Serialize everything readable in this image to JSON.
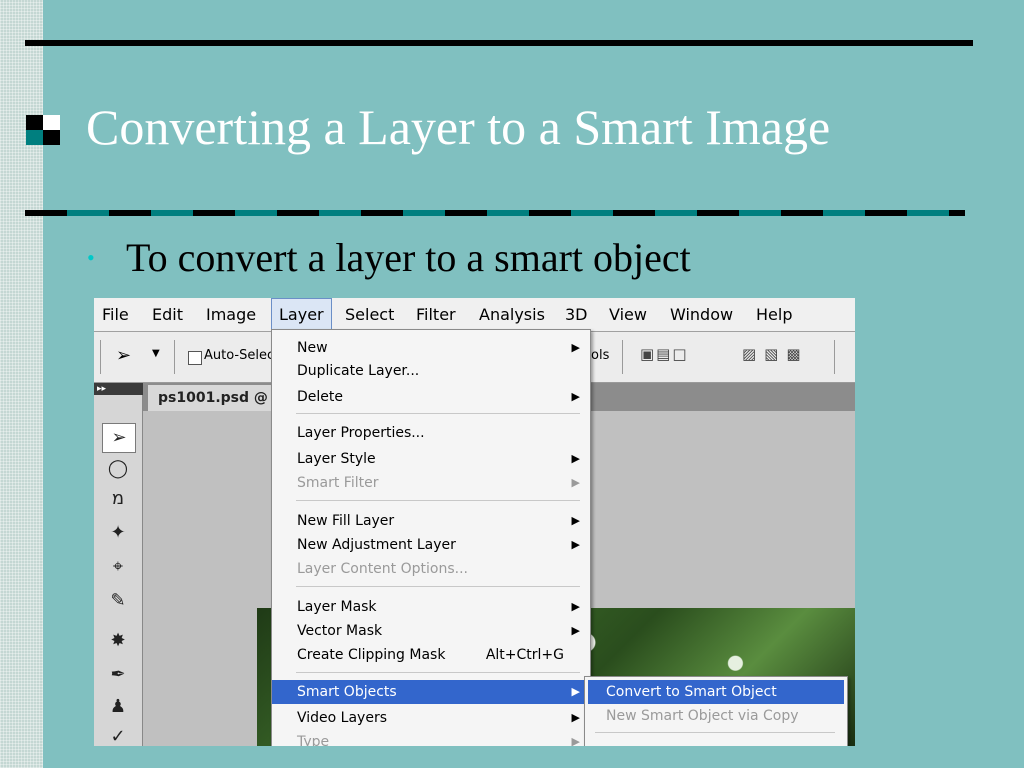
{
  "slide": {
    "title": "Converting a Layer to a Smart Image",
    "bullet": "To convert a layer to a smart object"
  },
  "colors": {
    "background": "#80c0c0",
    "title_text": "#ffffff",
    "menu_highlight": "#3366cc",
    "bullet": "#00c8c8"
  },
  "app": {
    "menubar": [
      "File",
      "Edit",
      "Image",
      "Layer",
      "Select",
      "Filter",
      "Analysis",
      "3D",
      "View",
      "Window",
      "Help"
    ],
    "active_menu": "Layer",
    "options_bar": {
      "auto_select_label": "Auto-Selec",
      "show_transform_partial": "ols"
    },
    "document_tab": "ps1001.psd @",
    "layer_menu": [
      {
        "label": "New",
        "arrow": true
      },
      {
        "label": "Duplicate Layer..."
      },
      {
        "label": "Delete",
        "arrow": true
      },
      {
        "separator": true
      },
      {
        "label": "Layer Properties..."
      },
      {
        "label": "Layer Style",
        "arrow": true
      },
      {
        "label": "Smart Filter",
        "arrow": true,
        "disabled": true
      },
      {
        "separator": true
      },
      {
        "label": "New Fill Layer",
        "arrow": true
      },
      {
        "label": "New Adjustment Layer",
        "arrow": true
      },
      {
        "label": "Layer Content Options...",
        "disabled": true
      },
      {
        "separator": true
      },
      {
        "label": "Layer Mask",
        "arrow": true
      },
      {
        "label": "Vector Mask",
        "arrow": true
      },
      {
        "label": "Create Clipping Mask",
        "shortcut": "Alt+Ctrl+G"
      },
      {
        "separator": true
      },
      {
        "label": "Smart Objects",
        "arrow": true,
        "highlighted": true
      },
      {
        "label": "Video Layers",
        "arrow": true
      },
      {
        "label": "Type",
        "arrow": true,
        "disabled": true
      }
    ],
    "smart_objects_submenu": [
      {
        "label": "Convert to Smart Object",
        "highlighted": true
      },
      {
        "label": "New Smart Object via Copy",
        "disabled": true
      }
    ],
    "tools": [
      "move-tool",
      "marquee-tool",
      "lasso-tool",
      "quick-select-tool",
      "crop-tool",
      "eyedropper-tool",
      "healing-tool",
      "brush-tool",
      "stamp-tool",
      "history-brush-tool"
    ]
  }
}
